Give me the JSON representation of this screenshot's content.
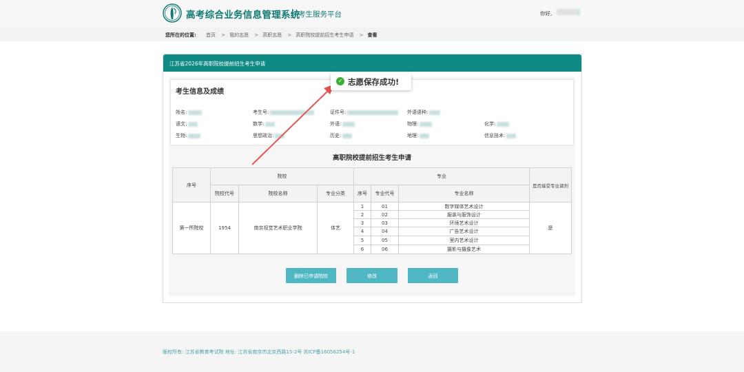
{
  "header": {
    "brand": "高考综合业务信息管理系统",
    "platform": "考生服务平台",
    "greeting": "你好,"
  },
  "breadcrumb": {
    "prefix": "您所在的位置:",
    "items": [
      "首页",
      "我的志愿",
      "高职志愿",
      "高职院校提前招生考生申请"
    ],
    "current": "查看",
    "separator": ">"
  },
  "panel": {
    "title": "江苏省2026年高职院校提前招生考生申请"
  },
  "toast": {
    "message": "志愿保存成功!",
    "icon": "check-icon"
  },
  "info": {
    "title": "考生信息及成绩",
    "fields": [
      {
        "label": "姓名:"
      },
      {
        "label": "考生号:"
      },
      {
        "label": "证件号:"
      },
      {
        "label": "外语语种:"
      },
      {
        "label": "语文:"
      },
      {
        "label": "数学:"
      },
      {
        "label": "外语:"
      },
      {
        "label": "物理:"
      },
      {
        "label": "化学:"
      },
      {
        "label": "生物:"
      },
      {
        "label": "思想政治:"
      },
      {
        "label": "历史:"
      },
      {
        "label": "地理:"
      },
      {
        "label": "信息技术:"
      }
    ]
  },
  "application": {
    "title": "高职院校提前招生考生申请",
    "headers": {
      "seq": "序号",
      "school": "院校",
      "school_code": "院校代号",
      "school_name": "院校名称",
      "major_category": "专业分类",
      "major": "专业",
      "major_seq": "序号",
      "major_code": "专业代号",
      "major_name": "专业名称",
      "adjust": "是否接受专业调剂"
    },
    "row": {
      "seq": "第一所院校",
      "school_code": "1954",
      "school_name": "南京视觉艺术职业学院",
      "category": "体艺",
      "adjust": "是"
    },
    "majors": [
      {
        "seq": "1",
        "code": "01",
        "name": "数字媒体艺术设计"
      },
      {
        "seq": "2",
        "code": "02",
        "name": "服装与服饰设计"
      },
      {
        "seq": "3",
        "code": "03",
        "name": "环境艺术设计"
      },
      {
        "seq": "4",
        "code": "04",
        "name": "广告艺术设计"
      },
      {
        "seq": "5",
        "code": "05",
        "name": "室内艺术设计"
      },
      {
        "seq": "6",
        "code": "06",
        "name": "摄影与摄像艺术"
      }
    ]
  },
  "buttons": {
    "delete": "删除已申请院校",
    "modify": "修改",
    "back": "返回"
  },
  "footer": {
    "text": "版权所有: 江苏省教育考试院 地址: 江苏省南京市北京西路15-2号 苏ICP备16056254号-1"
  },
  "colors": {
    "brand": "#0f7a72",
    "panel_header": "#0f8a84",
    "button": "#4eb7c3",
    "success": "#3cb034",
    "arrow": "#e8534f"
  }
}
